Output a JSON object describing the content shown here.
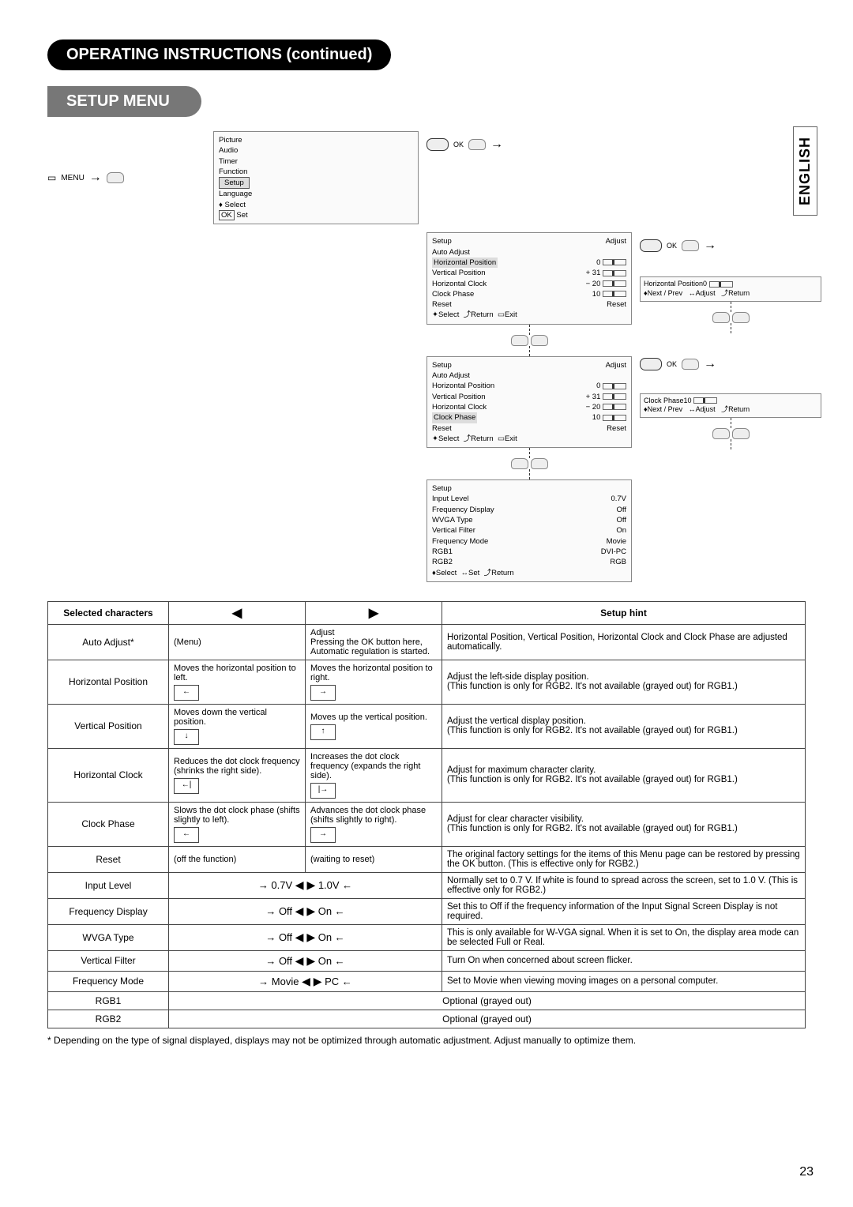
{
  "header": {
    "title": "OPERATING INSTRUCTIONS (continued)",
    "section": "SETUP MENU",
    "language_tab": "ENGLISH",
    "page_number": "23"
  },
  "diagram": {
    "menu_label": "MENU",
    "ok_label": "OK",
    "mainMenu": {
      "items": [
        "Picture",
        "Audio",
        "Timer",
        "Function",
        "Setup",
        "Language"
      ],
      "selected": "Setup",
      "footer_select": "Select",
      "footer_set": "Set",
      "footer_set_key": "OK"
    },
    "setup1": {
      "title": "Setup",
      "adjust": "Adjust",
      "items": [
        {
          "label": "Auto Adjust",
          "value": ""
        },
        {
          "label": "Horizontal Position",
          "value": "0"
        },
        {
          "label": "Vertical Position",
          "value": "+ 31"
        },
        {
          "label": "Horizontal Clock",
          "value": "− 20"
        },
        {
          "label": "Clock Phase",
          "value": "10"
        },
        {
          "label": "Reset",
          "value": "Reset"
        }
      ],
      "highlighted": "Horizontal Position",
      "footer": [
        "Select",
        "Return",
        "Exit"
      ]
    },
    "setup2": {
      "title": "Setup",
      "adjust": "Adjust",
      "items": [
        {
          "label": "Auto Adjust",
          "value": ""
        },
        {
          "label": "Horizontal Position",
          "value": "0"
        },
        {
          "label": "Vertical Position",
          "value": "+ 31"
        },
        {
          "label": "Horizontal Clock",
          "value": "− 20"
        },
        {
          "label": "Clock Phase",
          "value": "10"
        },
        {
          "label": "Reset",
          "value": "Reset"
        }
      ],
      "highlighted": "Clock Phase",
      "footer": [
        "Select",
        "Return",
        "Exit"
      ]
    },
    "setup3": {
      "title": "Setup",
      "items": [
        {
          "label": "Input Level",
          "value": "0.7V"
        },
        {
          "label": "Frequency Display",
          "value": "Off"
        },
        {
          "label": "WVGA Type",
          "value": "Off"
        },
        {
          "label": "Vertical Filter",
          "value": "On"
        },
        {
          "label": "Frequency Mode",
          "value": "Movie"
        },
        {
          "label": "RGB1",
          "value": "DVI-PC"
        },
        {
          "label": "RGB2",
          "value": "RGB"
        }
      ],
      "footer": [
        "Select",
        "Set",
        "Return"
      ]
    },
    "adjust1": {
      "label": "Horizontal Position",
      "value": "0",
      "footer": [
        "Next / Prev",
        "Adjust",
        "Return"
      ]
    },
    "adjust2": {
      "label": "Clock Phase",
      "value": "10",
      "footer": [
        "Next / Prev",
        "Adjust",
        "Return"
      ]
    }
  },
  "table": {
    "headers": {
      "col1": "Selected characters",
      "col2": "◀",
      "col3": "▶",
      "col4": "Setup hint"
    },
    "rows": [
      {
        "label": "Auto Adjust*",
        "left": "(Menu)",
        "right": "Adjust\nPressing the OK button here, Automatic regulation is started.",
        "hint": "Horizontal Position, Vertical Position, Horizontal Clock and Clock Phase are adjusted automatically."
      },
      {
        "label": "Horizontal Position",
        "left": "Moves the horizontal position to left.",
        "right": "Moves the horizontal position to right.",
        "hint": "Adjust the left-side display position.\n(This function is only for RGB2. It's not available (grayed out) for RGB1.)",
        "iconL": "←",
        "iconR": "→"
      },
      {
        "label": "Vertical Position",
        "left": "Moves down the vertical position.",
        "right": "Moves up the vertical position.",
        "hint": "Adjust the vertical display position.\n(This function is only for RGB2. It's not available (grayed out) for RGB1.)",
        "iconL": "↓",
        "iconR": "↑"
      },
      {
        "label": "Horizontal Clock",
        "left": "Reduces the dot clock frequency (shrinks the right side).",
        "right": "Increases the dot clock frequency (expands the right side).",
        "hint": "Adjust for maximum character clarity.\n(This function is only for RGB2. It's not available (grayed out) for RGB1.)",
        "iconL": "←|",
        "iconR": "|→"
      },
      {
        "label": "Clock Phase",
        "left": "Slows the dot clock phase (shifts slightly to left).",
        "right": "Advances the dot clock phase (shifts slightly to right).",
        "hint": "Adjust for clear character visibility.\n(This function is only for RGB2. It's not available (grayed out) for RGB1.)",
        "iconL": "←",
        "iconR": "→"
      },
      {
        "label": "Reset",
        "left": "(off the function)",
        "right": "(waiting to reset)",
        "hint": "The original factory settings for the items of this Menu page can be restored by pressing the OK button.  (This is effective only for RGB2.)"
      },
      {
        "label": "Input Level",
        "toggle": {
          "a": "0.7V",
          "b": "1.0V"
        },
        "hint": "Normally set to 0.7 V. If white is found to spread across the screen, set to 1.0 V. (This is effective only for RGB2.)"
      },
      {
        "label": "Frequency Display",
        "toggle": {
          "a": "Off",
          "b": "On"
        },
        "hint": "Set this to Off if the frequency information of the Input Signal Screen Display is not required."
      },
      {
        "label": "WVGA Type",
        "toggle": {
          "a": "Off",
          "b": "On"
        },
        "hint": "This is only available for W-VGA signal.\nWhen it is set to On, the display area mode can be selected Full or Real."
      },
      {
        "label": "Vertical Filter",
        "toggle": {
          "a": "Off",
          "b": "On"
        },
        "hint": "Turn On when concerned about screen flicker."
      },
      {
        "label": "Frequency Mode",
        "toggle": {
          "a": "Movie",
          "b": "PC"
        },
        "hint": "Set to Movie when viewing moving images on a personal computer."
      },
      {
        "label": "RGB1",
        "span": "Optional (grayed out)"
      },
      {
        "label": "RGB2",
        "span": "Optional (grayed out)"
      }
    ]
  },
  "footnote": "* Depending on the type of signal displayed, displays may not be optimized through automatic adjustment. Adjust manually to optimize them."
}
